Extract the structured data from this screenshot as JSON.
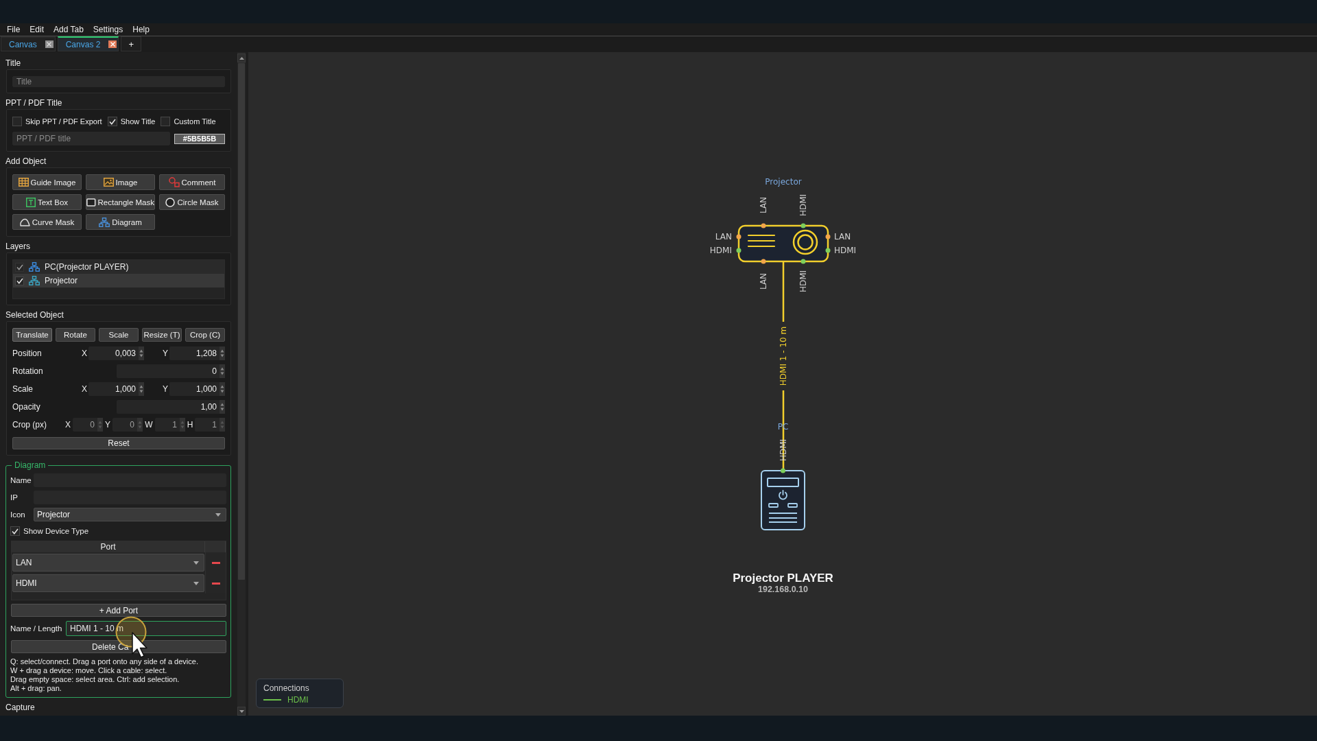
{
  "menu": [
    "File",
    "Edit",
    "Add Tab",
    "Settings",
    "Help"
  ],
  "tabs": [
    {
      "label": "Canvas",
      "selected": false
    },
    {
      "label": "Canvas 2",
      "selected": true
    }
  ],
  "add_tab": "+",
  "sidebar": {
    "title": {
      "heading": "Title",
      "placeholder": "Title"
    },
    "ppt": {
      "heading": "PPT / PDF Title",
      "options": [
        {
          "label": "Skip PPT / PDF Export",
          "checked": false
        },
        {
          "label": "Show Title",
          "checked": true
        },
        {
          "label": "Custom Title",
          "checked": false
        }
      ],
      "placeholder": "PPT / PDF title",
      "color_button": "#5B5B5B"
    },
    "add_object": {
      "heading": "Add Object",
      "buttons": [
        {
          "label": "Guide Image",
          "kind": "grid"
        },
        {
          "label": "Image",
          "kind": "picture"
        },
        {
          "label": "Comment",
          "kind": "comment"
        },
        {
          "label": "Text Box",
          "kind": "textbox"
        },
        {
          "label": "Rectangle Mask",
          "kind": "rectangle"
        },
        {
          "label": "Circle Mask",
          "kind": "circle"
        },
        {
          "label": "Curve Mask",
          "kind": "curve"
        },
        {
          "label": "Diagram",
          "kind": "diagram"
        }
      ]
    },
    "layers": {
      "heading": "Layers",
      "items": [
        {
          "label": "PC(Projector PLAYER)",
          "checked": true,
          "selected": false
        },
        {
          "label": "Projector",
          "checked": true,
          "selected": true
        }
      ]
    },
    "selected_object": {
      "heading": "Selected Object",
      "modes": [
        {
          "label": "Translate",
          "selected": true
        },
        {
          "label": "Rotate",
          "selected": false
        },
        {
          "label": "Scale",
          "selected": false
        },
        {
          "label": "Resize (T)",
          "selected": false
        },
        {
          "label": "Crop (C)",
          "selected": false
        }
      ],
      "rows": [
        {
          "kind": "pair",
          "label": "Position",
          "disabled": false,
          "fields": [
            {
              "axis": "X",
              "value": "0,003"
            },
            {
              "axis": "Y",
              "value": "1,208"
            }
          ]
        },
        {
          "kind": "single",
          "label": "Rotation",
          "disabled": false,
          "fields": [
            {
              "value": "0"
            }
          ]
        },
        {
          "kind": "pair",
          "label": "Scale",
          "disabled": false,
          "fields": [
            {
              "axis": "X",
              "value": "1,000"
            },
            {
              "axis": "Y",
              "value": "1,000"
            }
          ]
        },
        {
          "kind": "single",
          "label": "Opacity",
          "disabled": false,
          "fields": [
            {
              "value": "1,00"
            }
          ]
        },
        {
          "kind": "quad",
          "label": "Crop (px)",
          "disabled": true,
          "fields": [
            {
              "axis": "X",
              "value": "0"
            },
            {
              "axis": "Y",
              "value": "0"
            },
            {
              "axis": "W",
              "value": "1"
            },
            {
              "axis": "H",
              "value": "1"
            }
          ]
        }
      ],
      "reset": "Reset"
    },
    "diagram": {
      "heading": "Diagram",
      "fields": [
        {
          "kind": "text",
          "label": "Name"
        },
        {
          "kind": "text",
          "label": "IP"
        },
        {
          "kind": "select",
          "label": "Icon",
          "value": "Projector"
        }
      ],
      "show_device_type": {
        "label": "Show Device Type",
        "checked": true
      },
      "ports": {
        "header": "Port",
        "rows": [
          {
            "value": "LAN"
          },
          {
            "value": "HDMI"
          }
        ]
      },
      "add_port": "+ Add Port",
      "cable": {
        "label": "Name / Length",
        "value": "HDMI 1 - 10 m",
        "focused": true
      },
      "delete_button": "Delete Ca",
      "hints": [
        "Q: select/connect. Drag a port onto any side of a device.",
        "W + drag a device: move. Click a cable: select.",
        "Drag empty space: select area. Ctrl: add selection.",
        "Alt + drag: pan."
      ]
    },
    "capture": {
      "heading": "Capture"
    }
  },
  "canvas": {
    "devices": [
      {
        "kind": "projector",
        "type_label": "Projector",
        "selected": true,
        "ports": {
          "top": [
            {
              "label": "LAN",
              "color": "#f2a54a"
            },
            {
              "label": "HDMI",
              "color": "#7dcf5c"
            }
          ],
          "left": [
            {
              "label": "LAN",
              "color": "#f2a54a"
            },
            {
              "label": "HDMI",
              "color": "#7dcf5c"
            }
          ],
          "right": [
            {
              "label": "LAN",
              "color": "#f2a54a"
            },
            {
              "label": "HDMI",
              "color": "#7dcf5c"
            }
          ],
          "bottom": [
            {
              "label": "LAN",
              "color": "#f2a54a"
            },
            {
              "label": "HDMI",
              "color": "#7dcf5c"
            }
          ]
        }
      },
      {
        "kind": "player",
        "type_label": "PC",
        "selected": false,
        "ports": {
          "top": [
            {
              "label": "HDMI",
              "color": "#7dcf5c"
            }
          ]
        },
        "name": "Projector PLAYER",
        "ip": "192.168.0.10"
      }
    ],
    "cable": {
      "label": "HDMI 1 - 10 m",
      "selected": true
    },
    "legend": {
      "title": "Connections",
      "items": [
        {
          "label": "HDMI",
          "color": "#6cbf4a"
        }
      ]
    }
  }
}
